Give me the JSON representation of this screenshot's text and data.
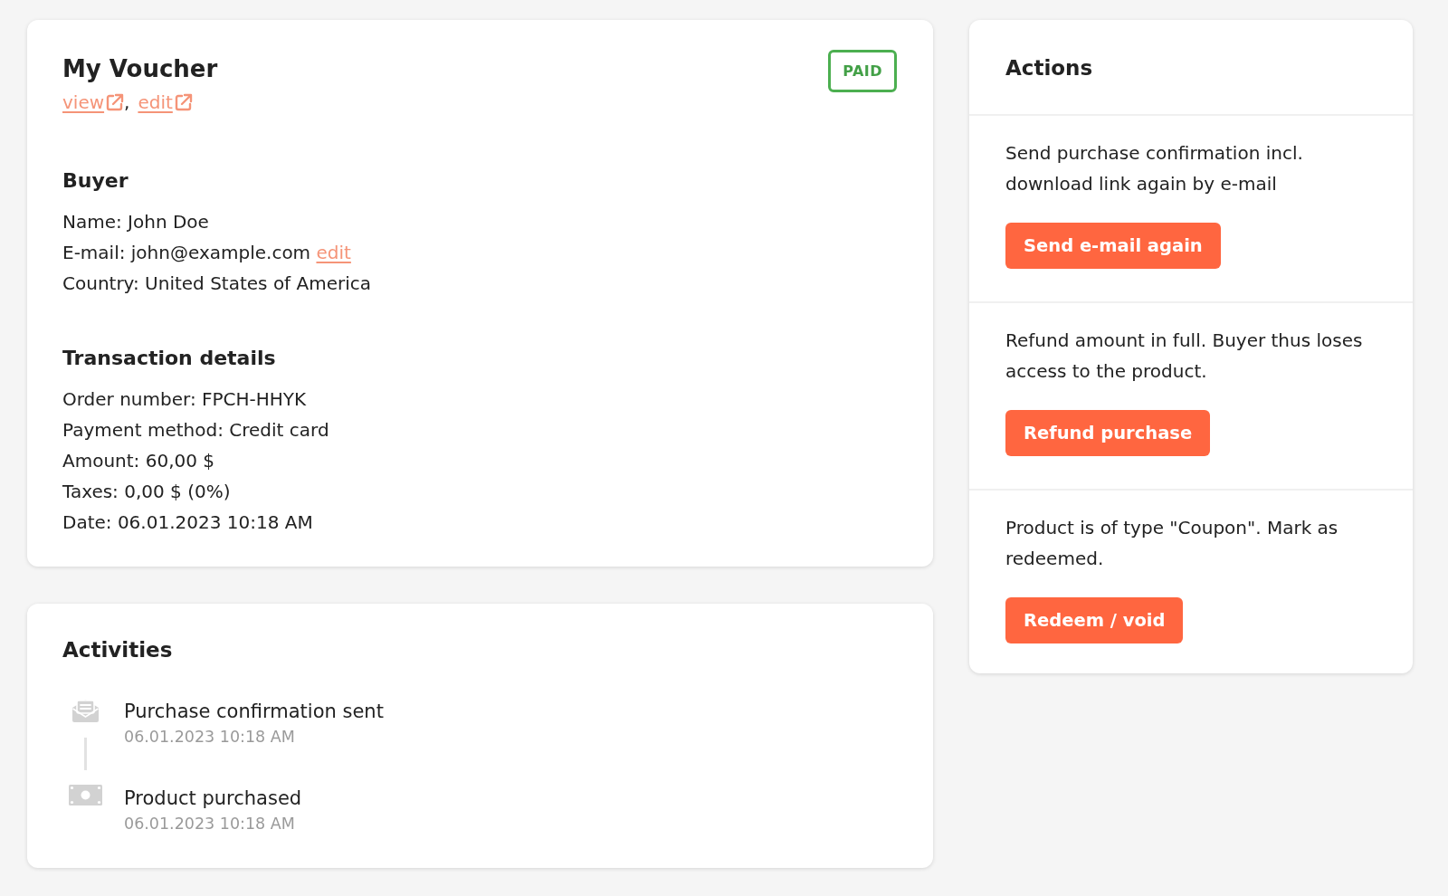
{
  "voucher": {
    "title": "My Voucher",
    "links": [
      {
        "label": "view"
      },
      {
        "label": "edit"
      }
    ],
    "link_separator": ",",
    "badge": "PAID",
    "sections": [
      {
        "heading": "Buyer",
        "lines": [
          {
            "text": "Name: John Doe"
          },
          {
            "text": "E-mail: john@example.com",
            "link": "edit"
          },
          {
            "text": "Country: United States of America"
          }
        ]
      },
      {
        "heading": "Transaction details",
        "lines": [
          {
            "text": "Order number: FPCH-HHYK"
          },
          {
            "text": "Payment method: Credit card"
          },
          {
            "text": "Amount: 60,00 $"
          },
          {
            "text": "Taxes: 0,00 $ (0%)"
          },
          {
            "text": "Date: 06.01.2023 10:18 AM"
          }
        ]
      }
    ]
  },
  "activities": {
    "title": "Activities",
    "items": [
      {
        "kind": "email",
        "title": "Purchase confirmation sent",
        "time": "06.01.2023 10:18 AM"
      },
      {
        "kind": "payment",
        "title": "Product purchased",
        "time": "06.01.2023 10:18 AM"
      }
    ]
  },
  "actions": {
    "title": "Actions",
    "items": [
      {
        "description": "Send purchase confirmation incl. download link again by e-mail",
        "button": "Send e-mail again"
      },
      {
        "description": "Refund amount in full. Buyer thus loses access to the product.",
        "button": "Refund purchase"
      },
      {
        "description": "Product is of type \"Coupon\". Mark as redeemed.",
        "button": "Redeem / void"
      }
    ]
  }
}
